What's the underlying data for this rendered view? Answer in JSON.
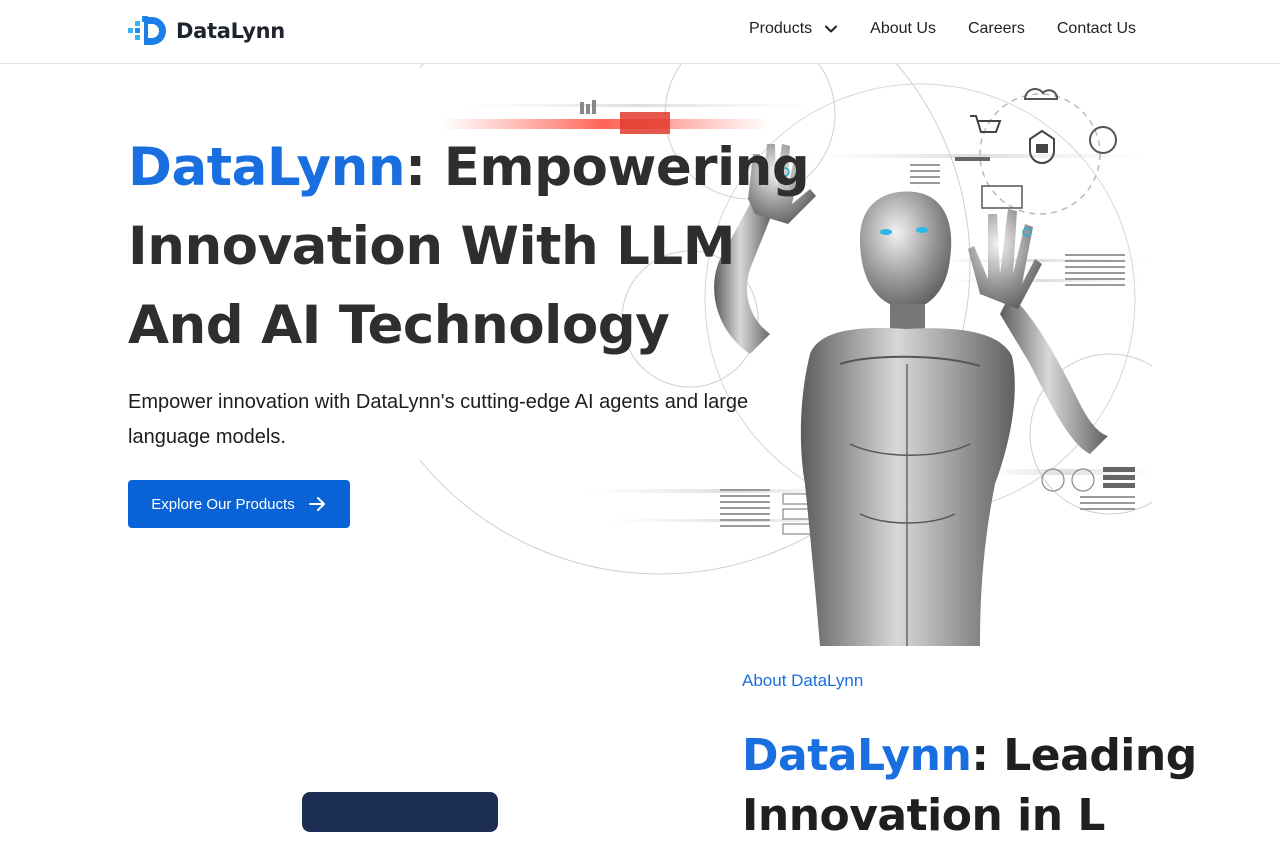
{
  "header": {
    "logo_text": "DataLynn",
    "nav": [
      {
        "label": "Products",
        "has_dropdown": true
      },
      {
        "label": "About Us"
      },
      {
        "label": "Careers"
      },
      {
        "label": "Contact Us"
      }
    ]
  },
  "hero": {
    "title_brand": "DataLynn",
    "title_line1_rest": ": Empowering",
    "title_line2": "Innovation With LLM",
    "title_line3": "And AI Technology",
    "subtitle": "Empower innovation with DataLynn's cutting-edge AI agents and large language models.",
    "cta_label": "Explore Our Products"
  },
  "about": {
    "eyebrow": "About DataLynn",
    "title_brand": "DataLynn",
    "title_rest": ": Leading",
    "title_line2_partial": "Innovation in L"
  },
  "colors": {
    "accent": "#1a6fe0",
    "button": "#0a63d6",
    "text": "#2e2e2e",
    "card": "#1c2e52"
  },
  "icons": [
    "logo-mark-icon",
    "chevron-down-icon",
    "arrow-right-icon"
  ]
}
